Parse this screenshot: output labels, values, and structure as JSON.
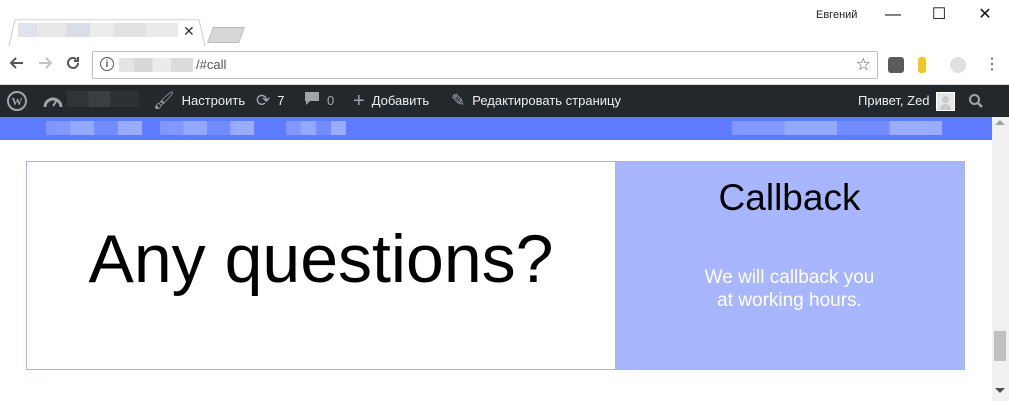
{
  "browser": {
    "profile_name": "Евгений",
    "url_suffix": "/#call",
    "window_buttons": {
      "minimize": "—",
      "maximize": "☐",
      "close": "✕"
    },
    "tab_close": "✕",
    "icons": {
      "back": "arrow-left-icon",
      "forward": "arrow-right-icon",
      "reload": "reload-icon",
      "info": "info-icon",
      "star": "star-icon",
      "menu": "kebab-menu-icon"
    }
  },
  "adminbar": {
    "customize_label": "Настроить",
    "updates_count": "7",
    "comments_count": "0",
    "add_label": "Добавить",
    "edit_label": "Редактировать страницу",
    "greeting": "Привет, Zed"
  },
  "page": {
    "headline": "Any questions?",
    "callback": {
      "title": "Callback",
      "text_line1": "We will callback you",
      "text_line2": "at working hours."
    }
  },
  "colors": {
    "adminbar_bg": "#23282d",
    "sitenav_bg": "#5f7bff",
    "callback_bg": "#a7b6ff",
    "card_border": "#a8b4e8"
  }
}
